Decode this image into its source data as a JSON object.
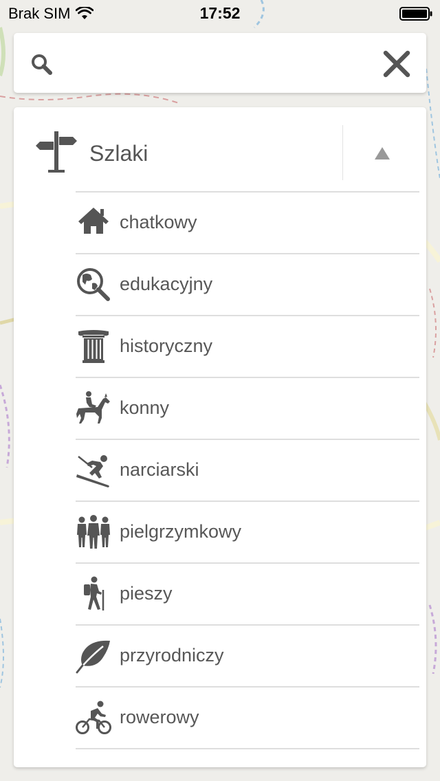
{
  "status_bar": {
    "carrier": "Brak SIM",
    "time": "17:52"
  },
  "search": {
    "placeholder": "",
    "value": ""
  },
  "panel": {
    "title": "Szlaki",
    "items": [
      {
        "label": "chatkowy",
        "icon": "house-icon"
      },
      {
        "label": "edukacyjny",
        "icon": "globe-magnifier-icon"
      },
      {
        "label": "historyczny",
        "icon": "column-icon"
      },
      {
        "label": "konny",
        "icon": "horse-rider-icon"
      },
      {
        "label": "narciarski",
        "icon": "skier-icon"
      },
      {
        "label": "pielgrzymkowy",
        "icon": "group-people-icon"
      },
      {
        "label": "pieszy",
        "icon": "hiker-icon"
      },
      {
        "label": "przyrodniczy",
        "icon": "leaf-icon"
      },
      {
        "label": "rowerowy",
        "icon": "cyclist-icon"
      }
    ]
  },
  "colors": {
    "icon": "#555555",
    "text": "#575757",
    "divider": "#dedede",
    "map_background": "#efeeea"
  }
}
